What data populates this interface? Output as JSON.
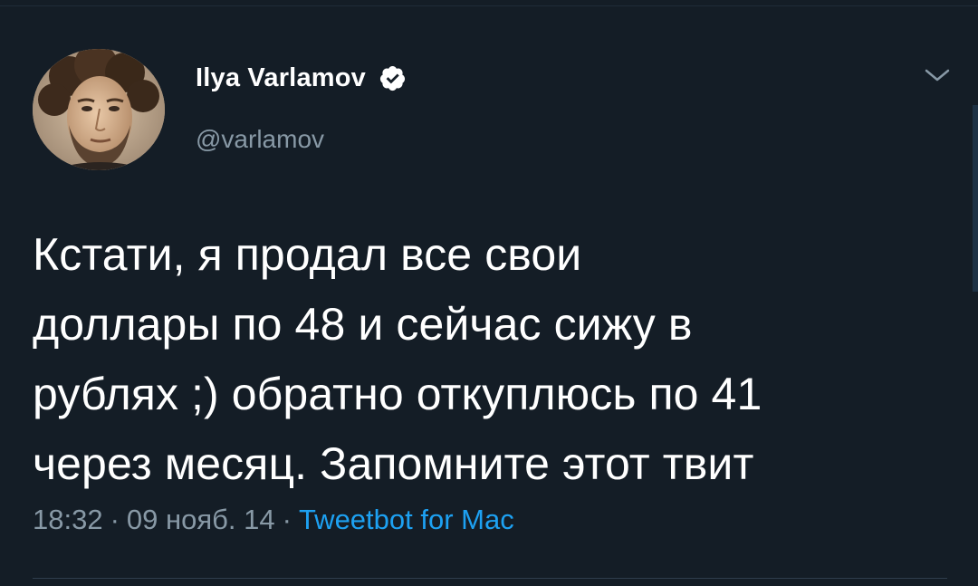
{
  "user": {
    "display_name": "Ilya Varlamov",
    "handle": "@varlamov",
    "verified_icon": "verified-badge-icon",
    "avatar_icon": "avatar"
  },
  "tweet": {
    "lines": [
      "Кстати, я продал все свои",
      "доллары по 48 и сейчас сижу в",
      "рублях ;) обратно откуплюсь по 41",
      "через месяц. Запомните этот твит"
    ]
  },
  "meta": {
    "time": "18:32",
    "date": "09 нояб. 14",
    "separator": "·",
    "source": "Tweetbot for Mac"
  },
  "colors": {
    "background": "#141d26",
    "text": "#ffffff",
    "secondary": "#8899a6",
    "accent": "#1da1f2"
  },
  "icons": {
    "menu": "chevron-down-icon"
  }
}
